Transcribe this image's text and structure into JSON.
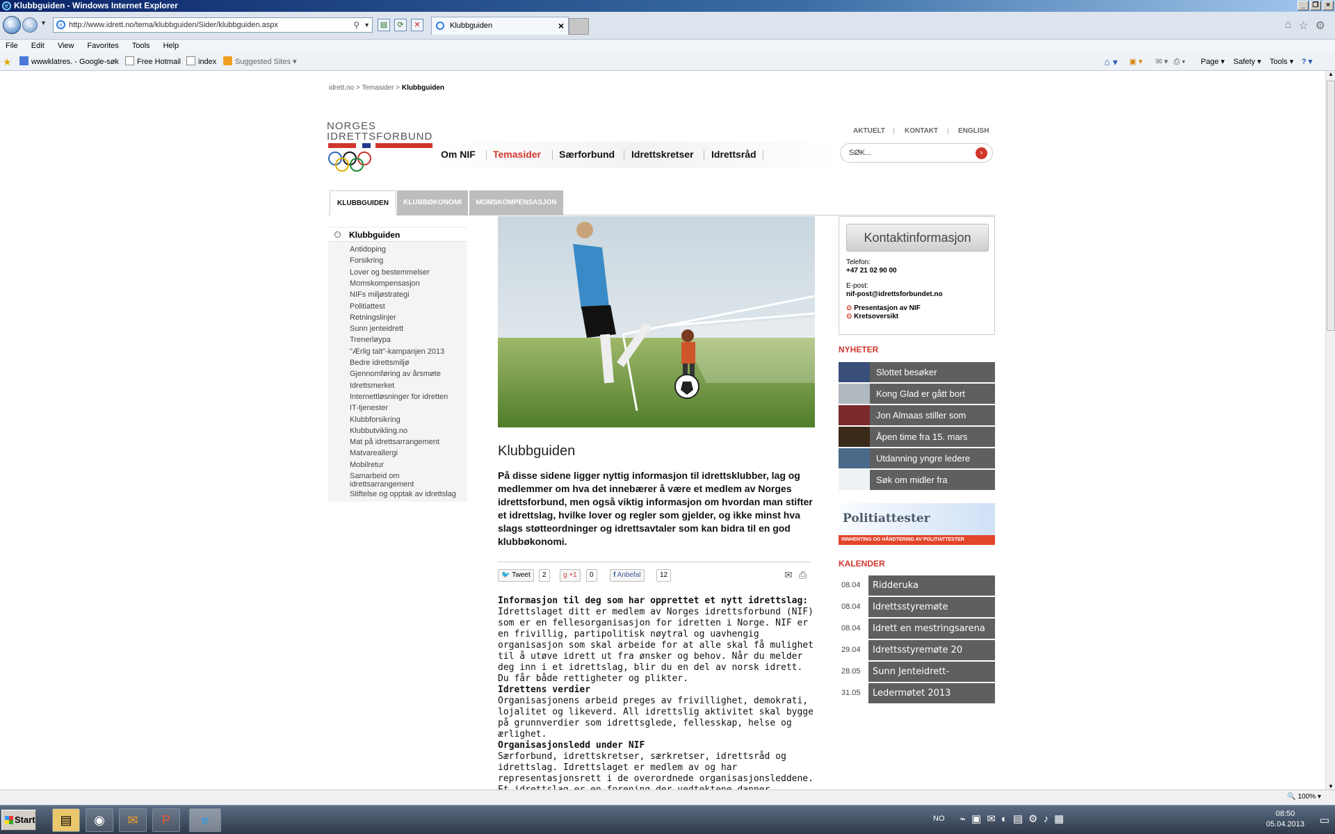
{
  "window": {
    "title": "Klubbguiden - Windows Internet Explorer"
  },
  "browser": {
    "url": "http://www.idrett.no/tema/klubbguiden/Sider/klubbguiden.aspx",
    "tab_title": "Klubbguiden",
    "menu": [
      "File",
      "Edit",
      "View",
      "Favorites",
      "Tools",
      "Help"
    ],
    "favorites": [
      "wwwklatres. - Google-søk",
      "Free Hotmail",
      "index",
      "Suggested Sites"
    ],
    "commands": [
      "Page",
      "Safety",
      "Tools"
    ],
    "zoom": "100%"
  },
  "breadcrumb": {
    "home": "idrett.no",
    "sep1": ">",
    "section": "Temasider",
    "sep2": ">",
    "current": "Klubbguiden"
  },
  "logo": {
    "line1": "NORGES",
    "line2": "IDRETTSFORBUND"
  },
  "topnav": [
    "AKTUELT",
    "|",
    "KONTAKT",
    "|",
    "ENGLISH"
  ],
  "mainnav": [
    "Om NIF",
    "Temasider",
    "Særforbund",
    "Idrettskretser",
    "Idrettsråd"
  ],
  "search": {
    "placeholder": "SØK..."
  },
  "subtabs": [
    "KLUBBGUIDEN",
    "KLUBBØKONOMI",
    "MOMSKOMPENSASJON"
  ],
  "sidebar": {
    "title": "Klubbguiden",
    "items": [
      "Antidoping",
      "Forsikring",
      "Lover og bestemmelser",
      "Momskompensasjon",
      "NIFs miljøstrategi",
      "Politiattest",
      "Retningslinjer",
      "Sunn jenteidrett",
      "Trenerløypa",
      "\"Ærlig talt\"-kampanjen 2013",
      "Bedre idrettsmiljø",
      "Gjennomføring av årsmøte",
      "Idrettsmerket",
      "Internettløsninger for idretten",
      "IT-tjenester",
      "Klubbforsikring",
      "Klubbutvikling.no",
      "Mat på idrettsarrangement",
      "Matvareallergi",
      "Mobilretur",
      "Samarbeid om idrettsarrangement",
      "Stiftelse og opptak av idrettslag"
    ]
  },
  "article": {
    "title": "Klubbguiden",
    "intro": "På disse sidene ligger nyttig informasjon til  idrettsklubber, lag og medlemmer om hva det innebærer å være et medlem av Norges idrettsforbund, men også viktig informasjon om hvordan man stifter et idrettslag, hvilke lover og regler som gjelder, og ikke minst hva slags støtteordninger og idrettsavtaler som kan bidra til en god klubbøkonomi.",
    "share": {
      "tweet": "Tweet",
      "tweet_count": "2",
      "gplus": "+1",
      "gplus_count": "0",
      "fb": "Anbefal",
      "fb_count": "12"
    },
    "sections": [
      {
        "heading": "Informasjon til deg som har opprettet et nytt idrettslag:",
        "text": "Idrettslaget ditt er medlem av Norges idrettsforbund (NIF) som er en fellesorganisasjon for idretten i Norge. NIF er en frivillig, partipolitisk nøytral og uavhengig organisasjon som skal arbeide for at alle skal få mulighet til å utøve idrett ut fra ønsker og behov. Når du melder deg inn i et idrettslag, blir du en del av norsk idrett. Du får både rettigheter og plikter."
      },
      {
        "heading": "Idrettens verdier",
        "text": "Organisasjonens arbeid preges av frivillighet, demokrati, lojalitet og likeverd. All idrettslig aktivitet skal bygge på grunnverdier som idrettsglede, fellesskap, helse og ærlighet."
      },
      {
        "heading": "Organisasjonsledd under NIF",
        "text": "Særforbund, idrettskretser, særkretser, idrettsråd og idrettslag. Idrettslaget er medlem av og har representasjonsrett i de overordnede organisasjonsleddene. Et idrettslag er en forening der vedtektene danner grunnlag for lagets virksomhet. NIF har vedtatt"
      }
    ]
  },
  "contact": {
    "button": "Kontaktinformasjon",
    "phone_label": "Telefon:",
    "phone": "+47 21 02 90 00",
    "email_label": "E-post:",
    "email": "nif-post@idrettsforbundet.no",
    "links": [
      "Presentasjon av NIF",
      "Kretsoversikt"
    ]
  },
  "news": {
    "heading": "NYHETER",
    "items": [
      "Slottet besøker",
      "Kong Glad er gått bort",
      "Jon Almaas stiller som",
      "Åpen time fra 15. mars",
      "Utdanning yngre ledere",
      "Søk om midler fra"
    ]
  },
  "banner": {
    "title": "Politiattester",
    "subtitle": "INNHENTING OG HÅNDTERING AV POLITIATTESTER"
  },
  "calendar": {
    "heading": "KALENDER",
    "items": [
      {
        "date": "08.04",
        "title": "Ridderuka"
      },
      {
        "date": "08.04",
        "title": "Idrettsstyremøte"
      },
      {
        "date": "08.04",
        "title": "Idrett en mestringsarena"
      },
      {
        "date": "29.04",
        "title": "Idrettsstyremøte 20"
      },
      {
        "date": "28.05",
        "title": "Sunn Jenteidrett-"
      },
      {
        "date": "31.05",
        "title": "Ledermøtet 2013"
      }
    ]
  },
  "taskbar": {
    "start": "Start",
    "lang": "NO",
    "time": "08:50",
    "date": "05.04.2013"
  },
  "colors": {
    "accent_red": "#d0362d",
    "dark_row": "#5f5f5f"
  }
}
